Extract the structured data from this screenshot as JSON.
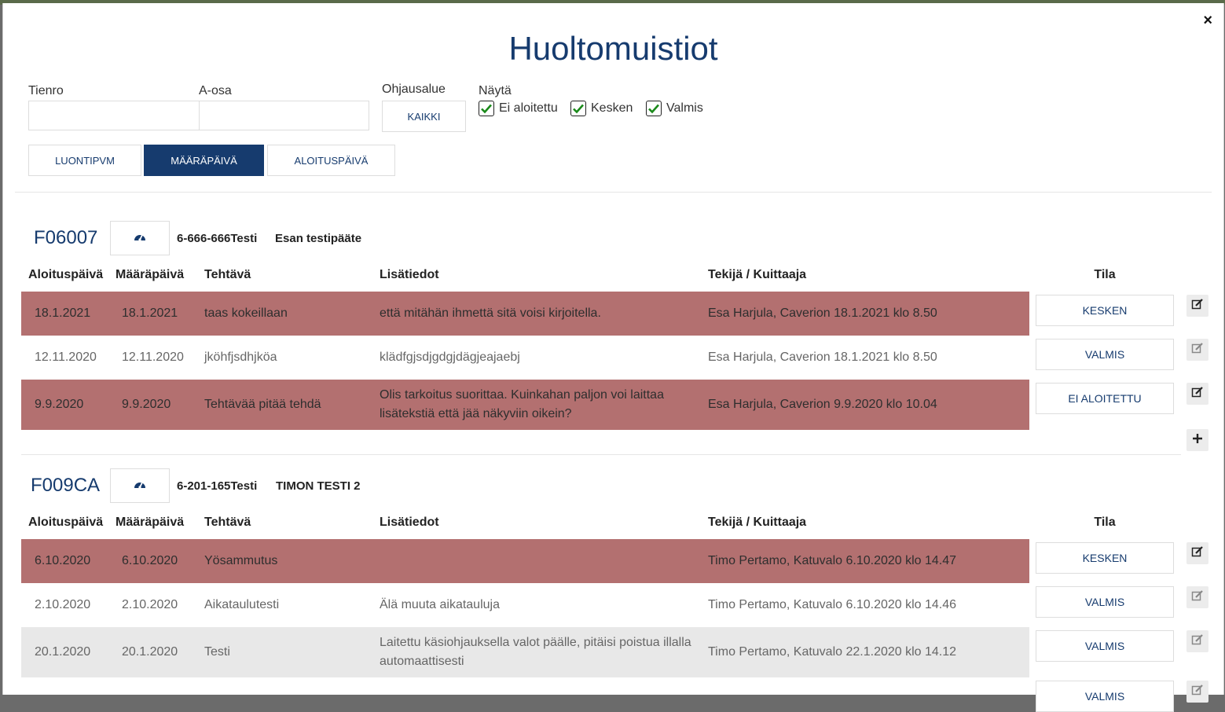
{
  "dialog": {
    "title": "Huoltomuistiot",
    "close_label": "×"
  },
  "filters": {
    "tienro_label": "Tienro",
    "tienro_value": "",
    "aosa_label": "A-osa",
    "aosa_value": "",
    "ohjausalue_label": "Ohjausalue",
    "ohjausalue_button": "KAIKKI",
    "nayta_label": "Näytä",
    "checkboxes": [
      {
        "label": "Ei aloitettu",
        "checked": true
      },
      {
        "label": "Kesken",
        "checked": true
      },
      {
        "label": "Valmis",
        "checked": true
      }
    ]
  },
  "sort_tabs": [
    {
      "label": "LUONTIPVM",
      "active": false
    },
    {
      "label": "MÄÄRÄPÄIVÄ",
      "active": true
    },
    {
      "label": "ALOITUSPÄIVÄ",
      "active": false
    }
  ],
  "columns": [
    "Aloituspäivä",
    "Määräpäivä",
    "Tehtävä",
    "Lisätiedot",
    "Tekijä / Kuittaaja",
    "Tila"
  ],
  "groups": [
    {
      "id": "F06007",
      "code": "6-666-666Testi",
      "name": "Esan testipääte",
      "rows": [
        {
          "start": "18.1.2021",
          "due": "18.1.2021",
          "task": "taas kokeillaan",
          "info": "että mitähän ihmettä sitä voisi kirjoitella.",
          "by": "Esa Harjula, Caverion 18.1.2021 klo 8.50",
          "state": "KESKEN",
          "style": "red"
        },
        {
          "start": "12.11.2020",
          "due": "12.11.2020",
          "task": "jköhfjsdhjköa",
          "info": "klädfgjsdjgdgjdägjeajaebj",
          "by": "Esa Harjula, Caverion 18.1.2021 klo 8.50",
          "state": "VALMIS",
          "style": "white"
        },
        {
          "start": "9.9.2020",
          "due": "9.9.2020",
          "task": "Tehtävää pitää tehdä",
          "info": "Olis tarkoitus suorittaa. Kuinkahan paljon voi laittaa lisätekstiä että jää näkyviin oikein?",
          "by": "Esa Harjula, Caverion 9.9.2020 klo 10.04",
          "state": "EI ALOITETTU",
          "style": "red"
        }
      ]
    },
    {
      "id": "F009CA",
      "code": "6-201-165Testi",
      "name": "TIMON TESTI 2",
      "rows": [
        {
          "start": "6.10.2020",
          "due": "6.10.2020",
          "task": "Yösammutus",
          "info": "",
          "by": "Timo Pertamo, Katuvalo 6.10.2020 klo 14.47",
          "state": "KESKEN",
          "style": "red"
        },
        {
          "start": "2.10.2020",
          "due": "2.10.2020",
          "task": "Aikataulutesti",
          "info": "Älä muuta aikatauluja",
          "by": "Timo Pertamo, Katuvalo 6.10.2020 klo 14.46",
          "state": "VALMIS",
          "style": "white"
        },
        {
          "start": "20.1.2020",
          "due": "20.1.2020",
          "task": "Testi",
          "info": "Laitettu käsiohjauksella valot päälle, pitäisi poistua illalla automaattisesti",
          "by": "Timo Pertamo, Katuvalo 22.1.2020 klo 14.12",
          "state": "VALMIS",
          "style": "grey"
        },
        {
          "state": "VALMIS",
          "style": "cut"
        }
      ]
    }
  ],
  "colors": {
    "accent": "#163b6e",
    "overdue_row": "#b37070",
    "check": "#1a8a1a"
  }
}
